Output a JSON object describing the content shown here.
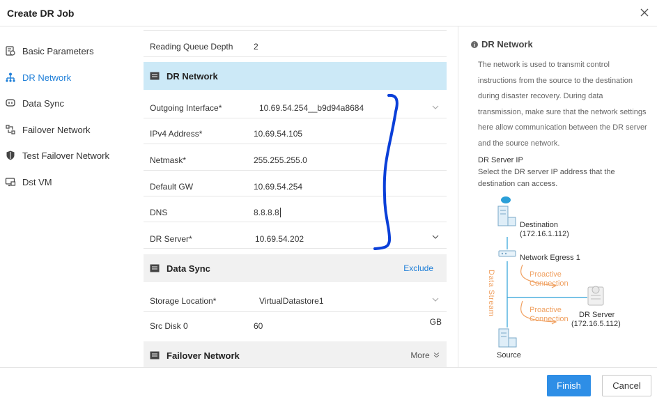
{
  "dialog": {
    "title": "Create DR Job"
  },
  "sidebar": {
    "items": [
      {
        "label": "Basic Parameters",
        "icon": "gear-icon"
      },
      {
        "label": "DR Network",
        "icon": "network-icon"
      },
      {
        "label": "Data Sync",
        "icon": "sync-icon"
      },
      {
        "label": "Failover Network",
        "icon": "failover-icon"
      },
      {
        "label": "Test Failover Network",
        "icon": "shield-icon"
      },
      {
        "label": "Dst VM",
        "icon": "monitor-icon"
      }
    ],
    "active_index": 1
  },
  "form": {
    "reading_queue_depth": {
      "label": "Reading Queue Depth",
      "value": "2"
    },
    "dr_network_section": {
      "title": "DR Network"
    },
    "outgoing_interface": {
      "label": "Outgoing Interface*",
      "value": "10.69.54.254__b9d94a8684"
    },
    "ipv4_address": {
      "label": "IPv4 Address*",
      "value": "10.69.54.105"
    },
    "netmask": {
      "label": "Netmask*",
      "value": "255.255.255.0"
    },
    "default_gw": {
      "label": "Default GW",
      "value": "10.69.54.254"
    },
    "dns": {
      "label": "DNS",
      "value": "8.8.8.8"
    },
    "dr_server": {
      "label": "DR Server*",
      "value": "10.69.54.202"
    },
    "data_sync_section": {
      "title": "Data Sync",
      "action": "Exclude"
    },
    "storage_location": {
      "label": "Storage Location*",
      "value": "VirtualDatastore1"
    },
    "src_disk": {
      "label": "Src Disk 0",
      "value": "60",
      "unit": "GB"
    },
    "failover_section": {
      "title": "Failover Network",
      "action": "More"
    }
  },
  "help": {
    "title": "DR Network",
    "description": "The network is used to transmit control instructions from the source to the destination during disaster recovery. During data transmission, make sure that the network settings here allow communication between the DR server and the source network.",
    "subtitle": "DR Server IP",
    "subdescription": "Select the DR server IP address that the destination can access.",
    "diagram": {
      "destination": "Destination",
      "destination_ip": "(172.16.1.112)",
      "network_egress": "Network Egress 1",
      "proactive_1a": "Proactive",
      "proactive_1b": "Connection",
      "data_stream": "Data Stream",
      "proactive_2a": "Proactive",
      "proactive_2b": "Connection",
      "dr_server": "DR Server",
      "dr_server_ip": "(172.16.5.112)",
      "source": "Source"
    }
  },
  "footer": {
    "finish_label": "Finish",
    "cancel_label": "Cancel"
  },
  "colors": {
    "accent": "#2e8ee6",
    "section_highlight": "#cce9f7",
    "annotation": "#0a3fd8"
  }
}
